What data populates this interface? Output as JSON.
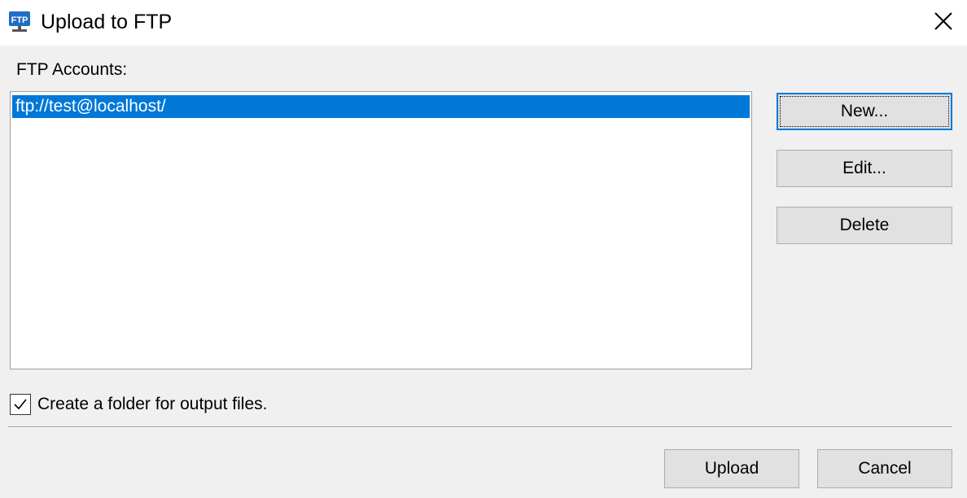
{
  "window": {
    "title": "Upload to FTP",
    "icon": "ftp-icon",
    "icon_text": "FTP"
  },
  "accounts": {
    "label": "FTP Accounts:",
    "items": [
      "ftp://test@localhost/"
    ],
    "selected_index": 0
  },
  "buttons": {
    "new": "New...",
    "edit": "Edit...",
    "delete": "Delete",
    "upload": "Upload",
    "cancel": "Cancel"
  },
  "options": {
    "create_folder_label": "Create a folder for output files.",
    "create_folder_checked": true
  },
  "colors": {
    "selection": "#0078d7",
    "focus_border": "#0078d7",
    "button_face": "#e1e1e1",
    "dialog_background": "#f0f0f0"
  }
}
